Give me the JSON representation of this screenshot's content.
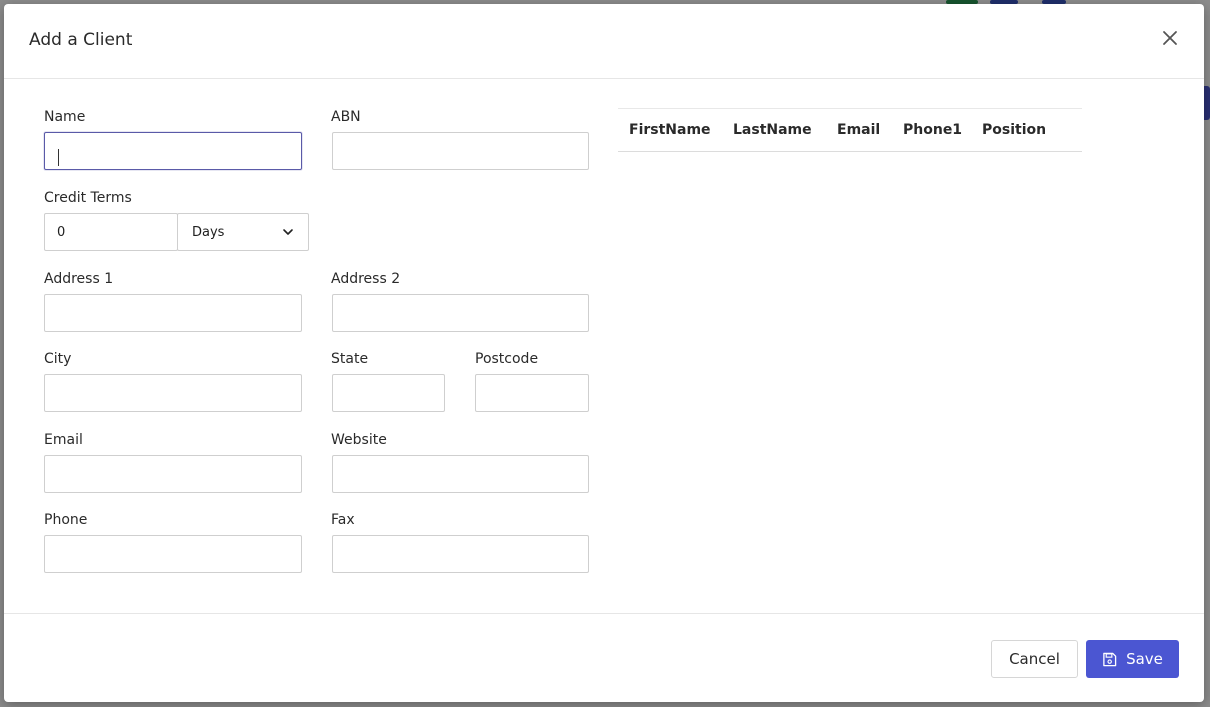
{
  "modal": {
    "title": "Add a Client"
  },
  "form": {
    "name": {
      "label": "Name",
      "value": ""
    },
    "abn": {
      "label": "ABN",
      "value": ""
    },
    "credit_terms": {
      "label": "Credit Terms",
      "value": "0",
      "unit_selected": "Days"
    },
    "address1": {
      "label": "Address 1",
      "value": ""
    },
    "address2": {
      "label": "Address 2",
      "value": ""
    },
    "city": {
      "label": "City",
      "value": ""
    },
    "state": {
      "label": "State",
      "value": ""
    },
    "postcode": {
      "label": "Postcode",
      "value": ""
    },
    "email": {
      "label": "Email",
      "value": ""
    },
    "website": {
      "label": "Website",
      "value": ""
    },
    "phone": {
      "label": "Phone",
      "value": ""
    },
    "fax": {
      "label": "Fax",
      "value": ""
    }
  },
  "contacts_table": {
    "columns": [
      "FirstName",
      "LastName",
      "Email",
      "Phone1",
      "Position"
    ]
  },
  "footer": {
    "cancel_label": "Cancel",
    "save_label": "Save"
  },
  "icons": {
    "close": "close-icon",
    "save": "floppy-disk-icon",
    "select": "chevron-down-icon"
  },
  "colors": {
    "primary": "#4b56d2",
    "focus_border": "#5a5aa8",
    "overlay": "#6f6f72"
  }
}
